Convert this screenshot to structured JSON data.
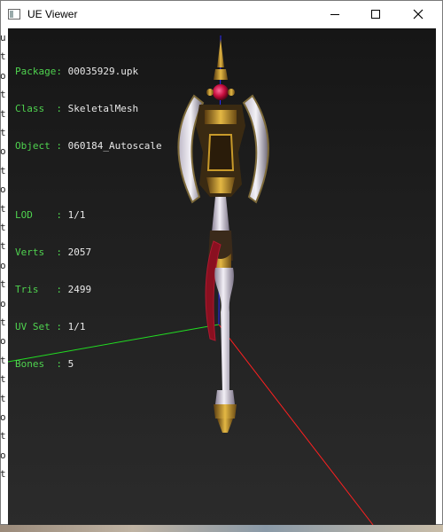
{
  "window": {
    "title": "UE Viewer"
  },
  "info": {
    "group1": [
      {
        "key": "Package",
        "sep": ": ",
        "value": "00035929.upk"
      },
      {
        "key": "Class  ",
        "sep": ": ",
        "value": "SkeletalMesh"
      },
      {
        "key": "Object ",
        "sep": ": ",
        "value": "060184_Autoscale"
      }
    ],
    "group2": [
      {
        "key": "LOD    ",
        "sep": ": ",
        "value": "1/1"
      },
      {
        "key": "Verts  ",
        "sep": ": ",
        "value": "2057"
      },
      {
        "key": "Tris   ",
        "sep": ": ",
        "value": "2499"
      },
      {
        "key": "UV Set ",
        "sep": ": ",
        "value": "1/1"
      },
      {
        "key": "Bones  ",
        "sep": ": ",
        "value": "5"
      }
    ]
  },
  "colors": {
    "label_green": "#4fd34f",
    "axis_x": "#ff2020",
    "axis_y": "#22dd22",
    "axis_z": "#2b2bff",
    "gem": "#d01040",
    "gold": "#c89a2a",
    "silver": "#d9d4e0"
  },
  "background_window": {
    "left_letters": [
      "u",
      "t",
      "o",
      "t",
      "t",
      "t",
      "o",
      "t",
      "o",
      "t",
      "t",
      "t",
      "o",
      "t",
      "o",
      "t",
      "o",
      "t",
      "t",
      "t",
      "o",
      "t",
      "o",
      "t"
    ]
  }
}
